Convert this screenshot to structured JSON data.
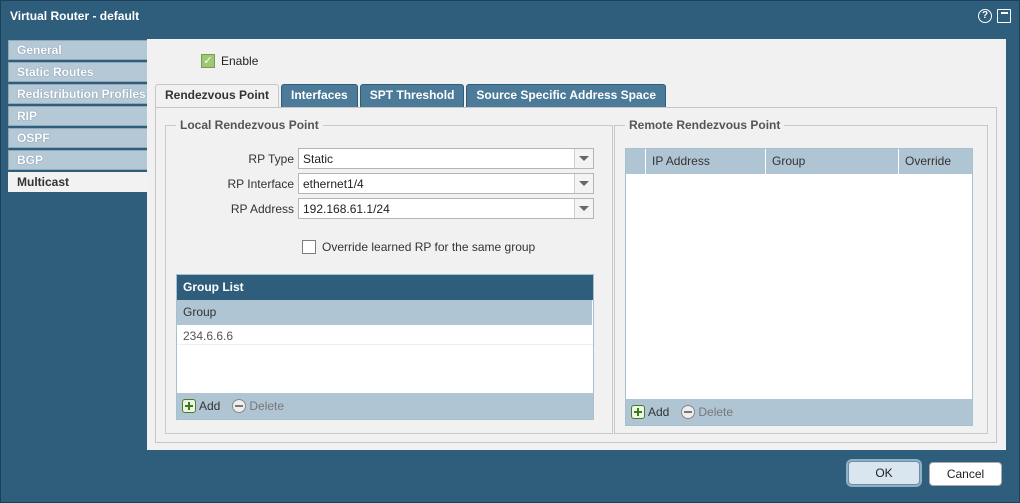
{
  "window": {
    "title": "Virtual Router - default",
    "help_icon": "?"
  },
  "nav": {
    "items": [
      {
        "label": "General"
      },
      {
        "label": "Static Routes"
      },
      {
        "label": "Redistribution Profiles"
      },
      {
        "label": "RIP"
      },
      {
        "label": "OSPF"
      },
      {
        "label": "BGP"
      },
      {
        "label": "Multicast"
      }
    ],
    "active": "Multicast"
  },
  "enable": {
    "label": "Enable",
    "checked": true
  },
  "tabs": [
    {
      "label": "Rendezvous Point"
    },
    {
      "label": "Interfaces"
    },
    {
      "label": "SPT Threshold"
    },
    {
      "label": "Source Specific Address Space"
    }
  ],
  "local": {
    "legend": "Local Rendezvous Point",
    "rp_type_label": "RP Type",
    "rp_type_value": "Static",
    "rp_interface_label": "RP Interface",
    "rp_interface_value": "ethernet1/4",
    "rp_address_label": "RP Address",
    "rp_address_value": "192.168.61.1/24",
    "override_label": "Override learned RP for the same group",
    "group_list": {
      "title": "Group List",
      "column": "Group",
      "rows": [
        "234.6.6.6"
      ],
      "add_label": "Add",
      "delete_label": "Delete"
    }
  },
  "remote": {
    "legend": "Remote Rendezvous Point",
    "columns": [
      "IP Address",
      "Group",
      "Override"
    ],
    "add_label": "Add",
    "delete_label": "Delete"
  },
  "footer": {
    "ok_label": "OK",
    "cancel_label": "Cancel"
  }
}
